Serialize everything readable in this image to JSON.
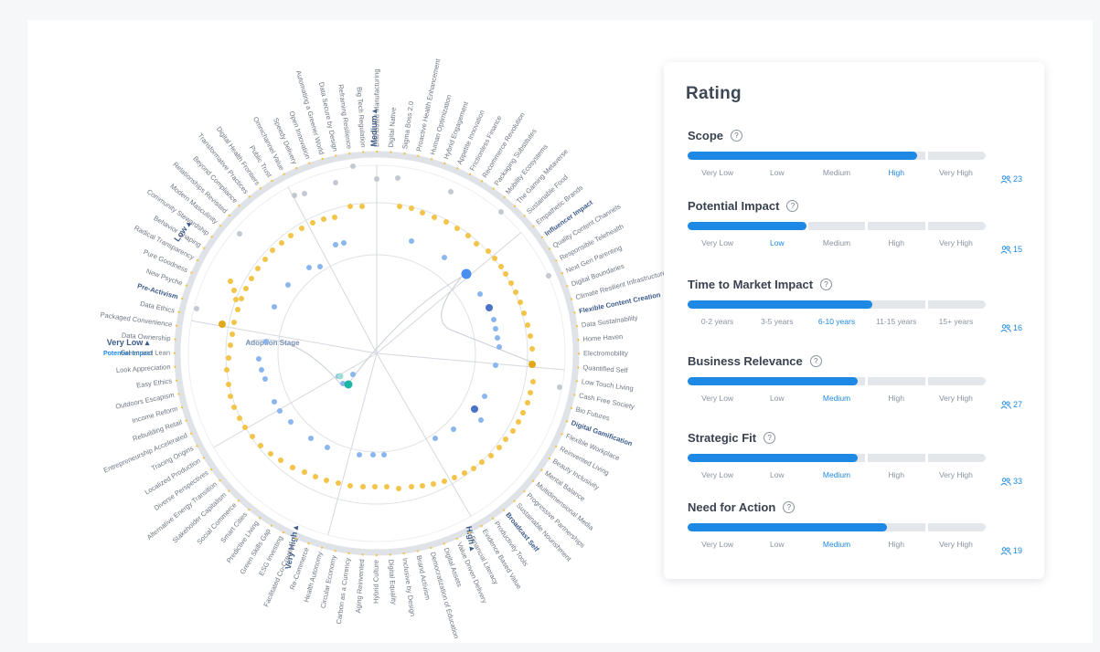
{
  "radar": {
    "rings": [
      "Medium",
      "Low",
      "Very Low",
      "Very High",
      "High"
    ],
    "ring_caption": "Potential Impact",
    "stage_label": "Adoption Stage",
    "labels": [
      "Digital Native",
      "Sigma Boss 2.0",
      "Proactive Health Enhancement",
      "Human Optimization",
      "Hybrid Engagement",
      "Appetite Innovation",
      "Frictionless Finance",
      "Recommerce Revolution",
      "Packaging Substitutes",
      "Mobility Ecosystems",
      "The Gaming Metaverse",
      "Sustainable Food",
      "Empathetic Brands",
      "Influencer Impact",
      "Quality Content Channels",
      "Responsible Telehealth",
      "Next Gen Parenting",
      "Digital Boundaries",
      "Climate Resilient Infrastructure",
      "Flexible Content Creation",
      "Data Sustainability",
      "Home Haven",
      "Electromobility",
      "Quantified Self",
      "Low Touch Living",
      "Cash Free Society",
      "Bio Futures",
      "Digital Gamification",
      "Flexible Workplace",
      "Reinvented Living",
      "Beauty Inclusivity",
      "Mental Balance",
      "Multidimensional Media",
      "Progressive Partnerships",
      "Sustainable Nourishment",
      "Broadcast Self",
      "Productivity Tools",
      "Evidence Based Value",
      "Financial Literacy",
      "Value Driven Delivery",
      "Digital Assets",
      "Democratization of Education",
      "Brand Activism",
      "Inclusive by Design",
      "Digital Equality",
      "Hybrid Culture",
      "Aging Reinvented",
      "Carbon as a Currency",
      "Circular Economy",
      "Health Autonomy",
      "Re-Commerce",
      "Facilitated Co-Creation",
      "ESG Investing",
      "Green Skills Gap",
      "Predictive Living",
      "Smart Cities",
      "Social Commerce",
      "Stakeholder Capitalism",
      "Alternative Energy Transition",
      "Diverse Perspectives",
      "Localized Production",
      "Tracing Origins",
      "Entrepreneurship Accelerated",
      "Rebuilding Retail",
      "Income Reform",
      "Outdoors Escapism",
      "Easy Ethics",
      "Look Appreciation",
      "Green and Lean",
      "Data Ownership",
      "Packaged Convenience",
      "Data Ethics",
      "Pre-Activism",
      "New Psyche",
      "Pure Goodness",
      "Radical Transparency",
      "Behavior Shaping",
      "Community Stewardship",
      "Modern Masculinity",
      "Relationships Revisited",
      "Beyond Compliance",
      "Transformative Practices",
      "Digital Health Frontiers",
      "Public Trust",
      "Omnichannel Value",
      "Speedy Delivery",
      "Open Innovation",
      "Automating a Greener World",
      "Data Secure by Design",
      "Reframing Resilience",
      "Big Tech Regulation",
      "Distributed Manufacturing"
    ]
  },
  "rating": {
    "title": "Rating",
    "help_glyph": "?",
    "sections": [
      {
        "id": "scope",
        "title": "Scope",
        "fill": 0.77,
        "labels": [
          "Very Low",
          "Low",
          "Medium",
          "High",
          "Very High"
        ],
        "selected": 3,
        "votes": "23"
      },
      {
        "id": "impact",
        "title": "Potential Impact",
        "fill": 0.4,
        "labels": [
          "Very Low",
          "Low",
          "Medium",
          "High",
          "Very High"
        ],
        "selected": 1,
        "votes": "15"
      },
      {
        "id": "ttm",
        "title": "Time to Market Impact",
        "fill": 0.62,
        "labels": [
          "0-2 years",
          "3-5 years",
          "6-10 years",
          "11-15 years",
          "15+ years"
        ],
        "selected": 2,
        "votes": "16"
      },
      {
        "id": "relevance",
        "title": "Business Relevance",
        "fill": 0.57,
        "labels": [
          "Very Low",
          "Low",
          "Medium",
          "High",
          "Very High"
        ],
        "selected": 2,
        "votes": "27"
      },
      {
        "id": "fit",
        "title": "Strategic Fit",
        "fill": 0.57,
        "labels": [
          "Very Low",
          "Low",
          "Medium",
          "High",
          "Very High"
        ],
        "selected": 2,
        "votes": "33"
      },
      {
        "id": "action",
        "title": "Need for Action",
        "fill": 0.67,
        "labels": [
          "Very Low",
          "Low",
          "Medium",
          "High",
          "Very High"
        ],
        "selected": 2,
        "votes": "19"
      }
    ]
  },
  "colors": {
    "accent": "#1e88e5",
    "dot_orange": "#f3c44a",
    "dot_blue": "#8ab6ef",
    "dot_grey": "#c4c9d0",
    "dot_teal": "#1bb5a5"
  }
}
